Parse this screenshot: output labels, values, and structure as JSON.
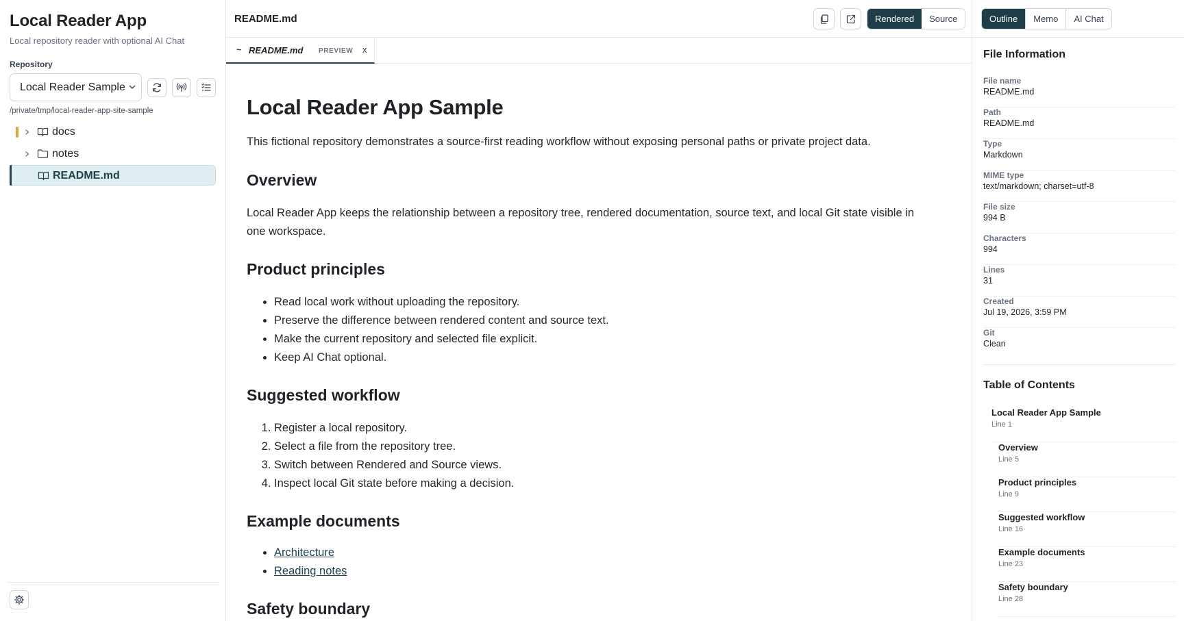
{
  "sidebar": {
    "app_title": "Local Reader App",
    "app_subtitle": "Local repository reader with optional AI Chat",
    "repository_label": "Repository",
    "repository_selected": "Local Reader Sample",
    "repository_path": "/private/tmp/local-reader-app-site-sample",
    "tree": [
      {
        "label": "docs",
        "kind": "folder",
        "icon": "book-icon",
        "expandable": true,
        "git_status_color": "#d8a73a"
      },
      {
        "label": "notes",
        "kind": "folder",
        "icon": "folder-icon",
        "expandable": true
      },
      {
        "label": "README.md",
        "kind": "file",
        "icon": "book-icon",
        "selected": true
      }
    ]
  },
  "main": {
    "file_title": "README.md",
    "view_modes": [
      "Rendered",
      "Source"
    ],
    "active_view": "Rendered",
    "tab": {
      "prefix": "~",
      "name": "README.md",
      "kind": "PREVIEW",
      "close": "x"
    },
    "doc": {
      "h1": "Local Reader App Sample",
      "intro": "This fictional repository demonstrates a source-first reading workflow without exposing personal paths or private project data.",
      "overview_heading": "Overview",
      "overview_text": "Local Reader App keeps the relationship between a repository tree, rendered documentation, source text, and local Git state visible in one workspace.",
      "principles_heading": "Product principles",
      "principles": [
        "Read local work without uploading the repository.",
        "Preserve the difference between rendered content and source text.",
        "Make the current repository and selected file explicit.",
        "Keep AI Chat optional."
      ],
      "workflow_heading": "Suggested workflow",
      "workflow": [
        "Register a local repository.",
        "Select a file from the repository tree.",
        "Switch between Rendered and Source views.",
        "Inspect local Git state before making a decision."
      ],
      "examples_heading": "Example documents",
      "examples": [
        "Architecture",
        "Reading notes"
      ],
      "safety_heading": "Safety boundary"
    }
  },
  "right_panel": {
    "tabs": [
      "Outline",
      "Memo",
      "AI Chat"
    ],
    "active_tab": "Outline",
    "file_info_title": "File Information",
    "file_info": [
      {
        "label": "File name",
        "value": "README.md"
      },
      {
        "label": "Path",
        "value": "README.md"
      },
      {
        "label": "Type",
        "value": "Markdown"
      },
      {
        "label": "MIME type",
        "value": "text/markdown; charset=utf-8"
      },
      {
        "label": "File size",
        "value": "994 B"
      },
      {
        "label": "Characters",
        "value": "994"
      },
      {
        "label": "Lines",
        "value": "31"
      },
      {
        "label": "Created",
        "value": "Jul 19, 2026, 3:59 PM"
      },
      {
        "label": "Git",
        "value": "Clean"
      }
    ],
    "toc_title": "Table of Contents",
    "toc": [
      {
        "title": "Local Reader App Sample",
        "line": "Line 1",
        "level": 1
      },
      {
        "title": "Overview",
        "line": "Line 5",
        "level": 2
      },
      {
        "title": "Product principles",
        "line": "Line 9",
        "level": 2
      },
      {
        "title": "Suggested workflow",
        "line": "Line 16",
        "level": 2
      },
      {
        "title": "Example documents",
        "line": "Line 23",
        "level": 2
      },
      {
        "title": "Safety boundary",
        "line": "Line 28",
        "level": 2
      }
    ]
  },
  "colors": {
    "accent_dark": "#1f3d49",
    "selected_row_bg": "#dfeef0",
    "git_modified": "#d8a73a"
  }
}
